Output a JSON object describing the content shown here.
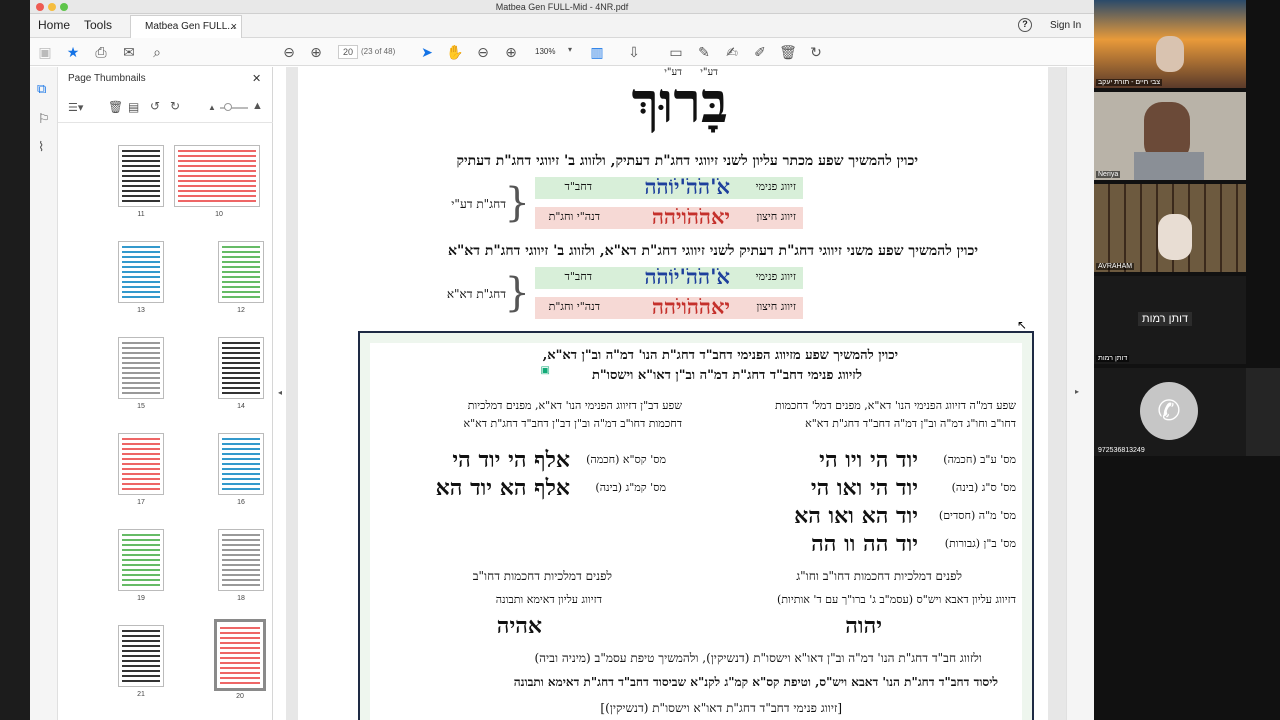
{
  "window": {
    "title": "Matbea Gen FULL-Mid - 4NR.pdf"
  },
  "tabs": {
    "home": "Home",
    "tools": "Tools",
    "doc_tab": "Matbea Gen FULL...",
    "close": "×"
  },
  "header": {
    "sign_in": "Sign In",
    "help": "?"
  },
  "toolbar": {
    "page_current": "20",
    "page_of": "(23 of 48)",
    "zoom": "130%"
  },
  "sidepanel": {
    "title": "Page Thumbnails",
    "close": "✕",
    "thumbnails": [
      {
        "label": "11"
      },
      {
        "label": "10"
      },
      {
        "label": "13"
      },
      {
        "label": "12"
      },
      {
        "label": "15"
      },
      {
        "label": "14"
      },
      {
        "label": "17"
      },
      {
        "label": "16"
      },
      {
        "label": "19"
      },
      {
        "label": "18"
      },
      {
        "label": "21"
      },
      {
        "label": "20"
      }
    ]
  },
  "pdf": {
    "nikud_top": "דע\"י",
    "nikud_top2": "דע\"י",
    "big_title": "בָּרוּךְ",
    "line1": "יכוין להמשיך שפע מכתר עליון לשני זיווגי דחג\"ת דעתיק, ולזווג ב' זיווגי דחג\"ת דעתיק",
    "block1": {
      "brace_label": "דחג\"ת דע\"י",
      "row1": {
        "type": "זיווג פנימי",
        "word": "אֹ'הֹהֹ'יֹוֹהֹה",
        "tag": "דחב\"ד"
      },
      "row2": {
        "type": "זיווג חיצון",
        "word": "יאהֹהֹויֹהה",
        "tag": "דנה\"י וחג\"ת"
      }
    },
    "line2": "יכוין להמשיך שפע משני זיווגי דחג\"ת דעתיק לשני זיווגי דחג\"ת דא\"א, ולזווג ב' זיווגי דחג\"ת דא\"א",
    "block2": {
      "brace_label": "דחג\"ת דא\"א",
      "row1": {
        "type": "זיווג פנימי",
        "word": "אֹ'הֹהֹ'יֹוֹהֹה",
        "tag": "דחב\"ד"
      },
      "row2": {
        "type": "זיווג חיצון",
        "word": "יאהֹהֹויֹהה",
        "tag": "דנה\"י וחג\"ת"
      }
    },
    "box": {
      "line1": "יכוין להמשיך שפע מזיווג הפנימי דחב\"ד דחג\"ת הנו' דמ\"ה וב\"ן דא\"א,",
      "line2": "לזיווג פנימי דחב\"ד דחג\"ת דמ\"ה וב\"ן דאו\"א וישסו\"ת",
      "right_head1": "שפע דמ\"ה דזיווג הפנימי הנו' דא\"א, מפנים דמל' דחכמות",
      "right_head2": "דחו\"ב וחו\"ג דמ\"ה וב\"ן דמ\"ה דחב\"ד דחג\"ת דא\"א",
      "left_head1": "שפע דב\"ן דזיווג הפנימי הנו' דא\"א, מפנים דמלכיות",
      "left_head2": "דחכמות דחו\"ב דמ\"ה וב\"ן דב\"ן דחב\"ד דחג\"ת דא\"א",
      "right_rows": [
        {
          "lab": "מס' ע\"ב (חכמה)",
          "name": "יוד הי ויו הי"
        },
        {
          "lab": "מס' ס\"ג (בינה)",
          "name": "יוד הי ואו הי"
        },
        {
          "lab": "מס' מ\"ה (חסדים)",
          "name": "יוד הא ואו הא"
        },
        {
          "lab": "מס' ב\"ן (גבורות)",
          "name": "יוד הה וו הה"
        }
      ],
      "left_rows": [
        {
          "lab": "מס' קס\"א (חכמה)",
          "name": "אלף הי יוד הי"
        },
        {
          "lab": "מס' קמ\"ג (בינה)",
          "name": "אלף הא יוד הא"
        }
      ],
      "right_low1": "לפנים דמלכיות דחכמות דחו\"ב וחו\"ג",
      "right_low2": "דזיווג עליון דאבא ויש\"ס (עסמ\"ב ג' ברו\"ך עם ד' אותיות)",
      "right_low_name": "יהוה",
      "left_low1": "לפנים דמלכיות דחכמות דחו\"ב",
      "left_low2": "דזיווג עליון דאימא ותבונה",
      "left_low_name": "אהיה",
      "bottom1": "ולזווג חב\"ד דחג\"ת הנו' דמ\"ה וב\"ן דאו\"א וישסו\"ת (דנשיקין), ולהמשיך טיפת עסמ\"ב (מיניה וביה)",
      "bottom2": "ליסוד דחב\"ד דחג\"ת הנו' דאבא ויש\"ס, וטיפת קס\"א קמ\"ג לקנ\"א שביסוד דחב\"ד דחג\"ת דאימא ותבונה",
      "bottom3": "[זיווג פנימי דחב\"ד דחג\"ת דאו\"א וישסו\"ת (דנשיקין)]"
    }
  },
  "zoom": {
    "participants": [
      {
        "name": "צבי חיים - תורת יעקב"
      },
      {
        "name": "Neriya"
      },
      {
        "name": "AVRAHAM"
      },
      {
        "name": "דותן רמות",
        "center": "דותן רמות"
      },
      {
        "name": "972536813249"
      }
    ]
  },
  "colors": {
    "accent": "#1473e6",
    "green_box": "#d8efd9",
    "pink_box": "#f6d9d5",
    "blue_text": "#1d3f9c",
    "red_text": "#c4302b"
  }
}
